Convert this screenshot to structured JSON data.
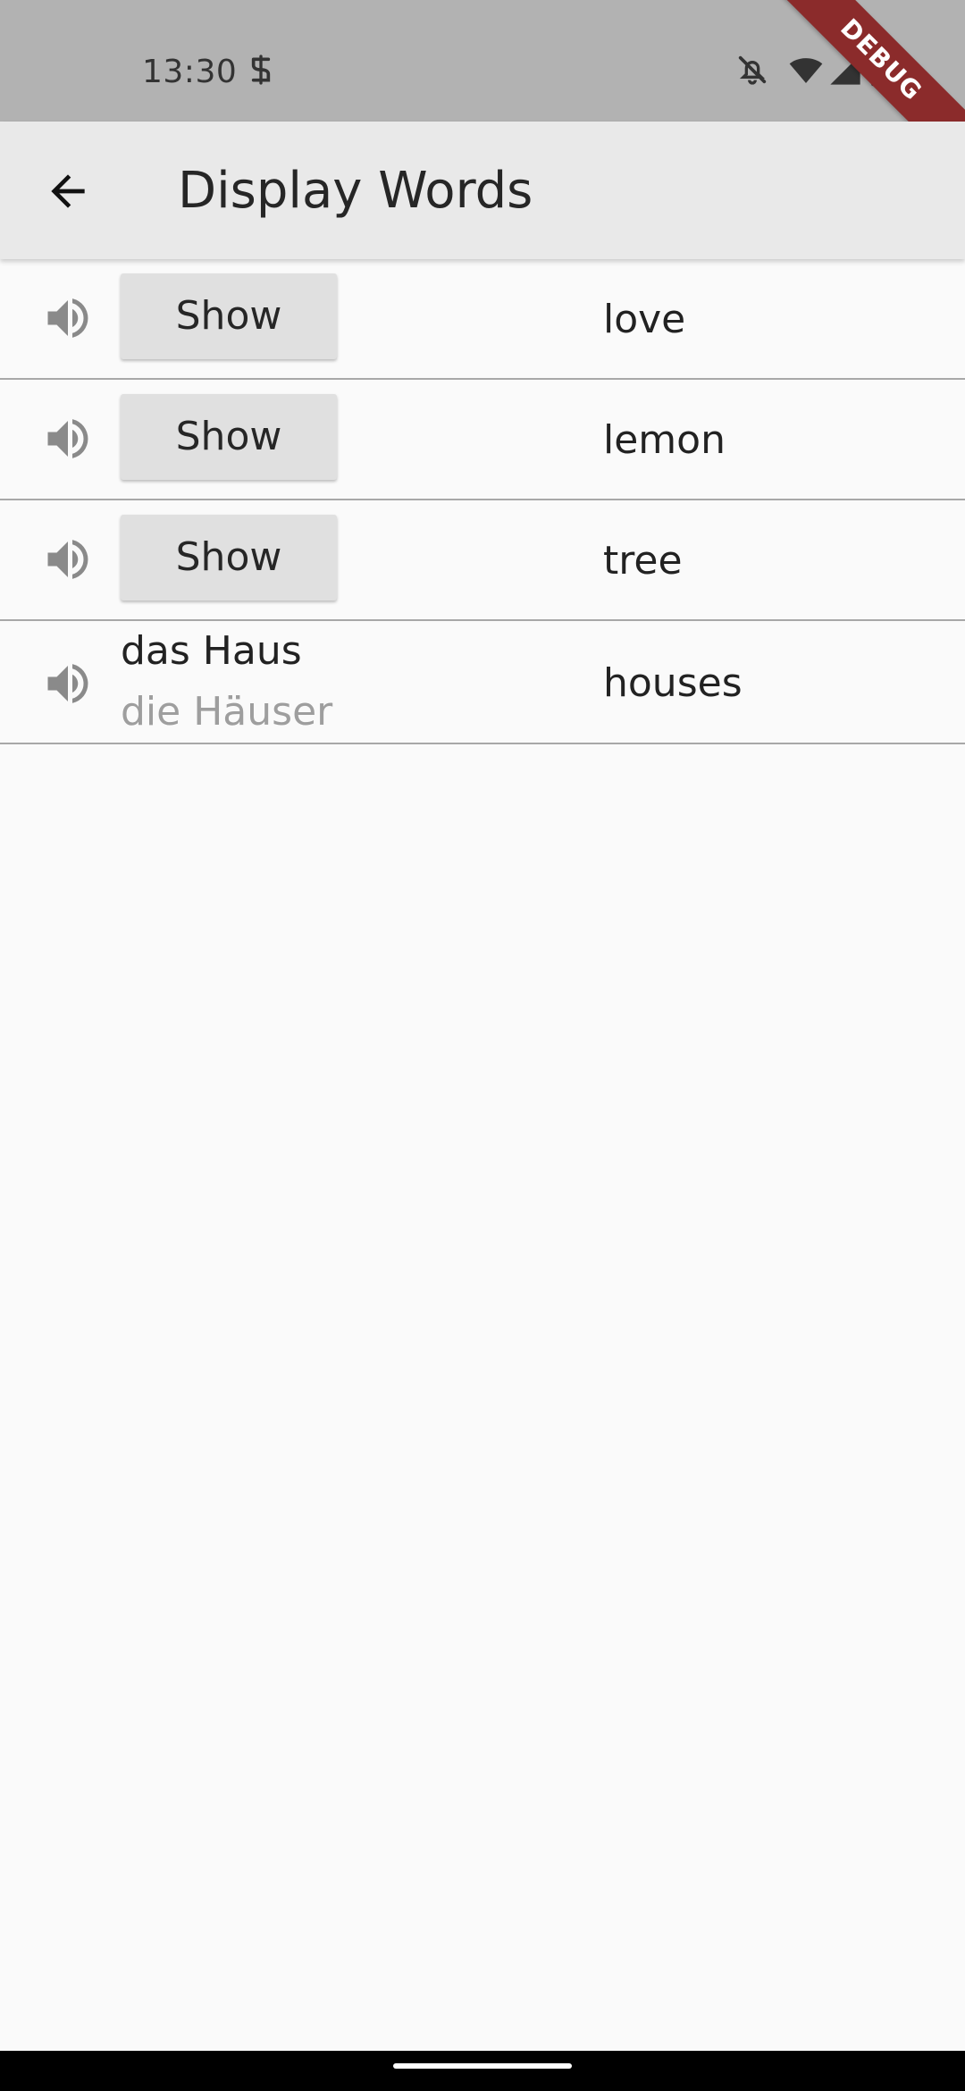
{
  "status_bar": {
    "time": "13:30",
    "icons": [
      "notification-app-icon",
      "bell-off-icon",
      "wifi-icon",
      "cell-signal-icon",
      "battery-icon"
    ]
  },
  "debug_banner": "DEBUG",
  "app_bar": {
    "back_icon": "arrow-back-icon",
    "title": "Display Words"
  },
  "words": [
    {
      "state": "hidden",
      "button_label": "Show",
      "translation": "love"
    },
    {
      "state": "hidden",
      "button_label": "Show",
      "translation": "lemon"
    },
    {
      "state": "hidden",
      "button_label": "Show",
      "translation": "tree"
    },
    {
      "state": "revealed",
      "singular": "das Haus",
      "plural": "die Häuser",
      "translation": "houses"
    }
  ],
  "colors": {
    "status_bar": "#b2b2b2",
    "app_bar": "#e9e9e9",
    "background": "#fafafa",
    "button": "#e0e0e0",
    "speaker_icon": "#8a8a8a",
    "secondary_text": "#9e9e9e",
    "debug_banner": "#8b2b2b"
  }
}
